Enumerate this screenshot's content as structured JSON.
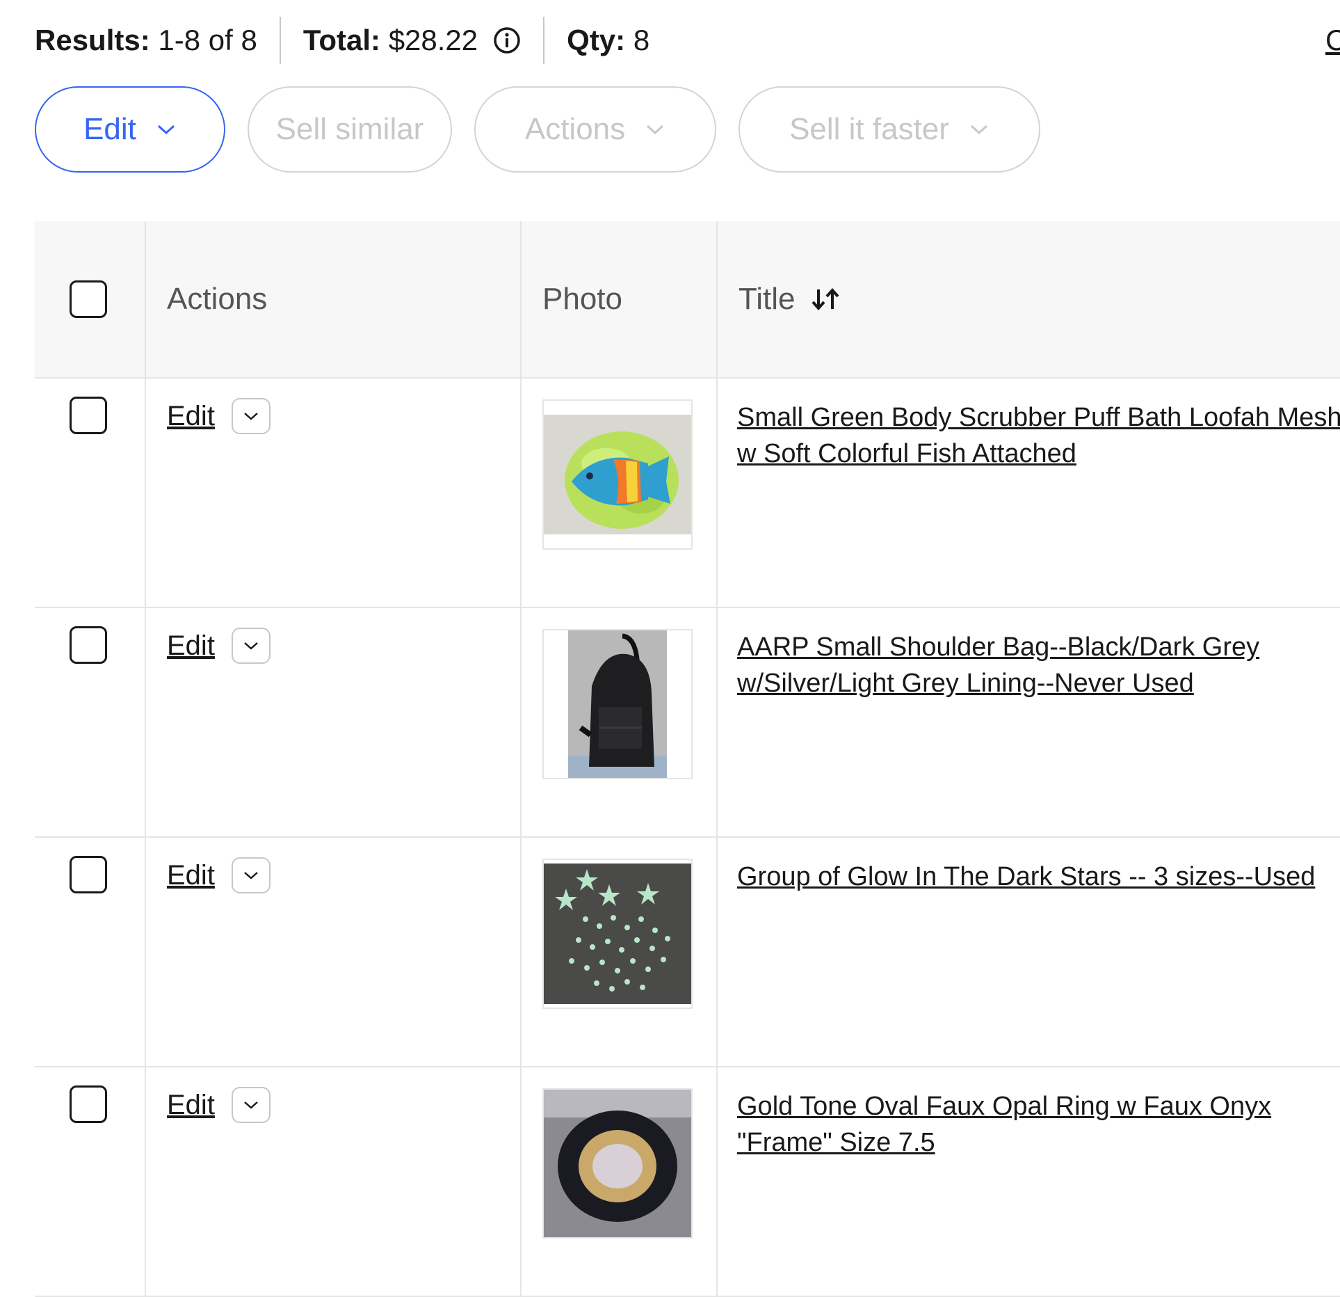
{
  "summary": {
    "results_label": "Results:",
    "results_value": "1-8 of 8",
    "total_label": "Total:",
    "total_value": "$28.22",
    "qty_label": "Qty:",
    "qty_value": "8",
    "cut_link": "C"
  },
  "toolbar": {
    "edit": "Edit",
    "sell_similar": "Sell similar",
    "actions": "Actions",
    "sell_it_faster": "Sell it faster"
  },
  "table": {
    "headers": {
      "actions": "Actions",
      "photo": "Photo",
      "title": "Title"
    },
    "rows": [
      {
        "edit": "Edit",
        "title": "Small Green Body Scrubber Puff Bath Loofah Mesh w Soft Colorful Fish Attached",
        "photo_icon": "fish-loofah-photo"
      },
      {
        "edit": "Edit",
        "title": "AARP Small Shoulder Bag--Black/Dark Grey w/Silver/Light Grey Lining--Never Used",
        "photo_icon": "black-bag-photo"
      },
      {
        "edit": "Edit",
        "title": "Group of Glow In The Dark Stars -- 3 sizes--Used",
        "photo_icon": "stars-photo"
      },
      {
        "edit": "Edit",
        "title": "Gold Tone Oval Faux Opal Ring w Faux Onyx \"Frame\" Size 7.5",
        "photo_icon": "ring-photo"
      }
    ]
  },
  "colors": {
    "accent": "#3665f3",
    "disabled": "#c7c7c7",
    "border": "#e5e5e5",
    "header_bg": "#f7f7f7"
  }
}
